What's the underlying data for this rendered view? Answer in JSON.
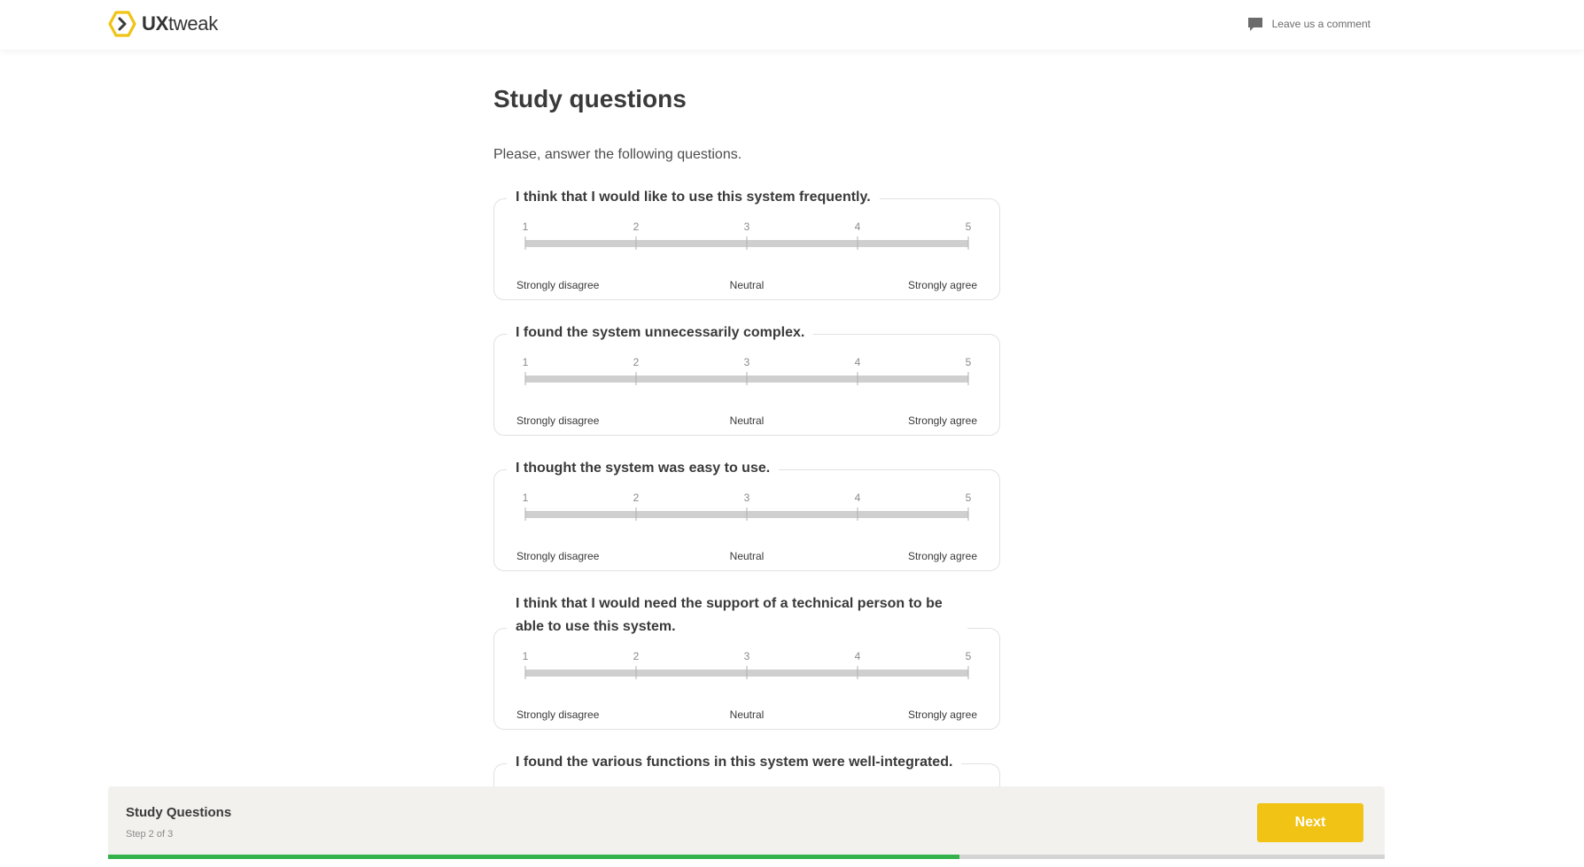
{
  "header": {
    "logo_text_bold": "UX",
    "logo_text_rest": "tweak",
    "comment_label": "Leave us a comment"
  },
  "page": {
    "title": "Study questions",
    "intro": "Please, answer the following questions."
  },
  "scale": {
    "points": [
      "1",
      "2",
      "3",
      "4",
      "5"
    ],
    "label_low": "Strongly disagree",
    "label_mid": "Neutral",
    "label_high": "Strongly agree"
  },
  "questions": [
    {
      "text": "I think that I would like to use this system frequently."
    },
    {
      "text": "I found the system unnecessarily complex."
    },
    {
      "text": "I thought the system was easy to use."
    },
    {
      "text": "I think that I would need the support of a technical person to be able to use this system."
    },
    {
      "text": "I found the various functions in this system were well-integrated."
    }
  ],
  "footer": {
    "title": "Study Questions",
    "step": "Step 2 of 3",
    "next_label": "Next",
    "progress_fraction": 0.667
  },
  "colors": {
    "accent": "#f0c315",
    "progress": "#33b24a",
    "logo": "#f0c315"
  },
  "icons": {
    "logo": "hexagon-chevron-logo-icon",
    "comment": "speech-bubble-icon"
  }
}
